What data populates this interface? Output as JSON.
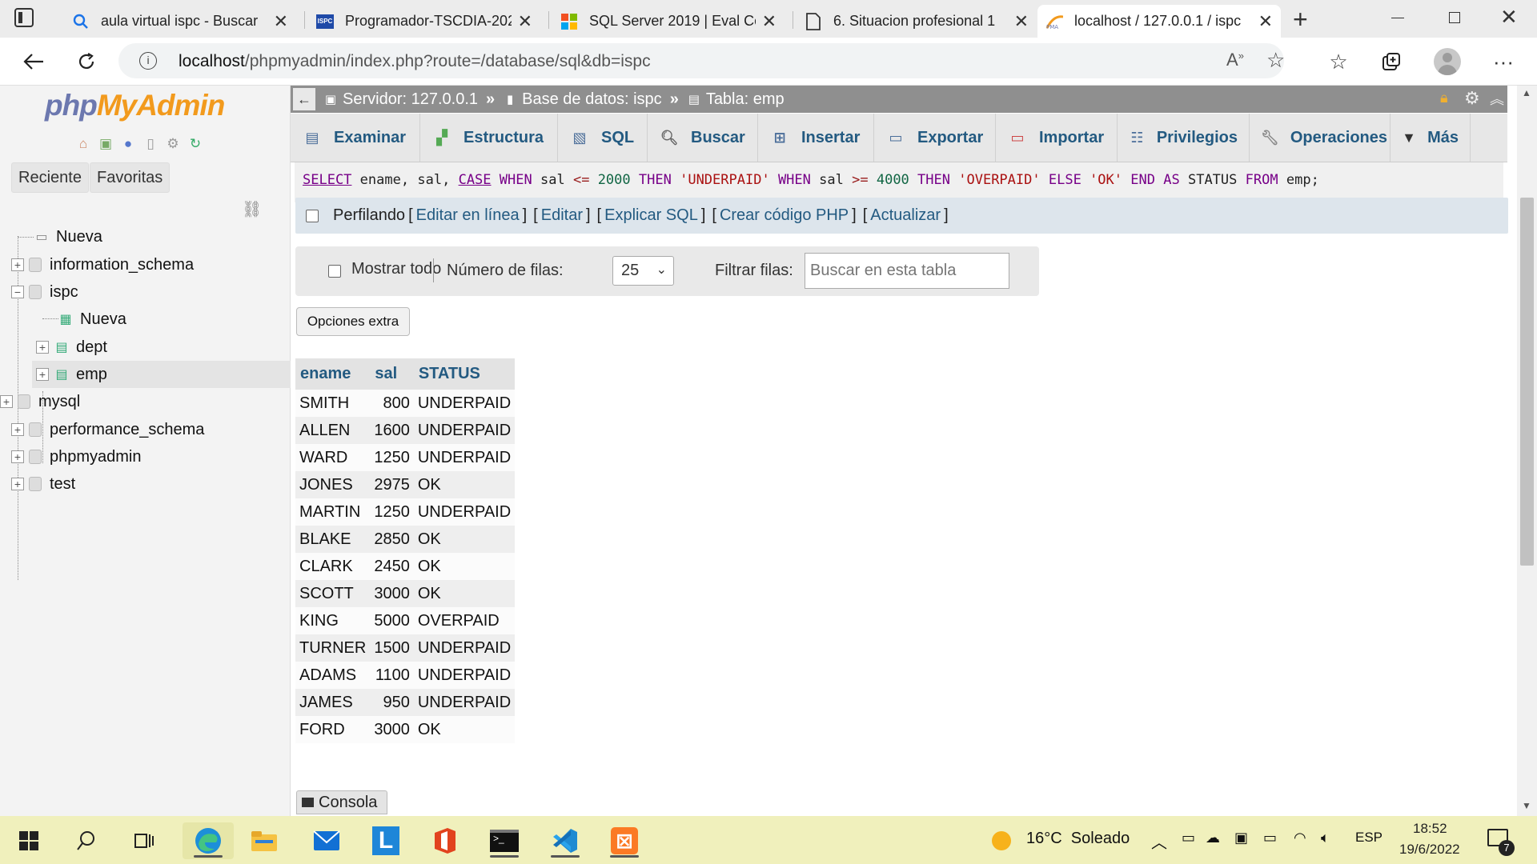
{
  "browser": {
    "tabs": [
      {
        "title": "aula virtual ispc - Buscar",
        "favicon": "search-icon"
      },
      {
        "title": "Programador-TSCDIA-202",
        "favicon": "ispc-icon"
      },
      {
        "title": "SQL Server 2019 | Eval Cen",
        "favicon": "microsoft-icon"
      },
      {
        "title": "6. Situacion profesional 1",
        "favicon": "document-icon"
      },
      {
        "title": "localhost / 127.0.0.1 / ispc",
        "favicon": "phpmyadmin-icon",
        "active": true
      }
    ],
    "url_host": "localhost",
    "url_path": "/phpmyadmin/index.php?route=/database/sql&db=ispc"
  },
  "sidebar": {
    "logo_php": "php",
    "logo_myadmin": "MyAdmin",
    "tab_recent": "Reciente",
    "tab_favorites": "Favoritas",
    "tree": {
      "new": "Nueva",
      "databases": [
        "information_schema",
        "ispc",
        "mysql",
        "performance_schema",
        "phpmyadmin",
        "test"
      ],
      "ispc_children": {
        "new": "Nueva",
        "tables": [
          "dept",
          "emp"
        ]
      }
    }
  },
  "breadcrumb": {
    "server": "Servidor: 127.0.0.1",
    "database": "Base de datos: ispc",
    "table": "Tabla: emp",
    "separator": "»"
  },
  "menu_tabs": [
    {
      "label": "Examinar",
      "icon": "browse-icon"
    },
    {
      "label": "Estructura",
      "icon": "structure-icon"
    },
    {
      "label": "SQL",
      "icon": "sql-icon"
    },
    {
      "label": "Buscar",
      "icon": "search-icon"
    },
    {
      "label": "Insertar",
      "icon": "insert-icon"
    },
    {
      "label": "Exportar",
      "icon": "export-icon"
    },
    {
      "label": "Importar",
      "icon": "import-icon"
    },
    {
      "label": "Privilegios",
      "icon": "privileges-icon"
    },
    {
      "label": "Operaciones",
      "icon": "operations-icon"
    },
    {
      "label": "Más",
      "icon": "chevron-down-icon"
    }
  ],
  "sql": {
    "query": "SELECT ename, sal, CASE WHEN sal <= 2000 THEN 'UNDERPAID' WHEN sal >= 4000 THEN 'OVERPAID' ELSE 'OK' END AS STATUS FROM emp;"
  },
  "profiling": {
    "label": "Perfilando",
    "links": [
      "Editar en línea",
      "Editar",
      "Explicar SQL",
      "Crear código PHP",
      "Actualizar"
    ]
  },
  "filters": {
    "show_all": "Mostrar todo",
    "rows_label": "Número de filas:",
    "rows_value": "25",
    "filter_label": "Filtrar filas:",
    "filter_placeholder": "Buscar en esta tabla"
  },
  "extra_options": "Opciones extra",
  "results": {
    "columns": [
      "ename",
      "sal",
      "STATUS"
    ],
    "rows": [
      [
        "SMITH",
        "800",
        "UNDERPAID"
      ],
      [
        "ALLEN",
        "1600",
        "UNDERPAID"
      ],
      [
        "WARD",
        "1250",
        "UNDERPAID"
      ],
      [
        "JONES",
        "2975",
        "OK"
      ],
      [
        "MARTIN",
        "1250",
        "UNDERPAID"
      ],
      [
        "BLAKE",
        "2850",
        "OK"
      ],
      [
        "CLARK",
        "2450",
        "OK"
      ],
      [
        "SCOTT",
        "3000",
        "OK"
      ],
      [
        "KING",
        "5000",
        "OVERPAID"
      ],
      [
        "TURNER",
        "1500",
        "UNDERPAID"
      ],
      [
        "ADAMS",
        "1100",
        "UNDERPAID"
      ],
      [
        "JAMES",
        "950",
        "UNDERPAID"
      ],
      [
        "FORD",
        "3000",
        "OK"
      ]
    ]
  },
  "console_label": "Consola",
  "taskbar": {
    "weather": "16°C  Soleado",
    "language": "ESP",
    "time": "18:52",
    "date": "19/6/2022",
    "notifications": "7"
  }
}
